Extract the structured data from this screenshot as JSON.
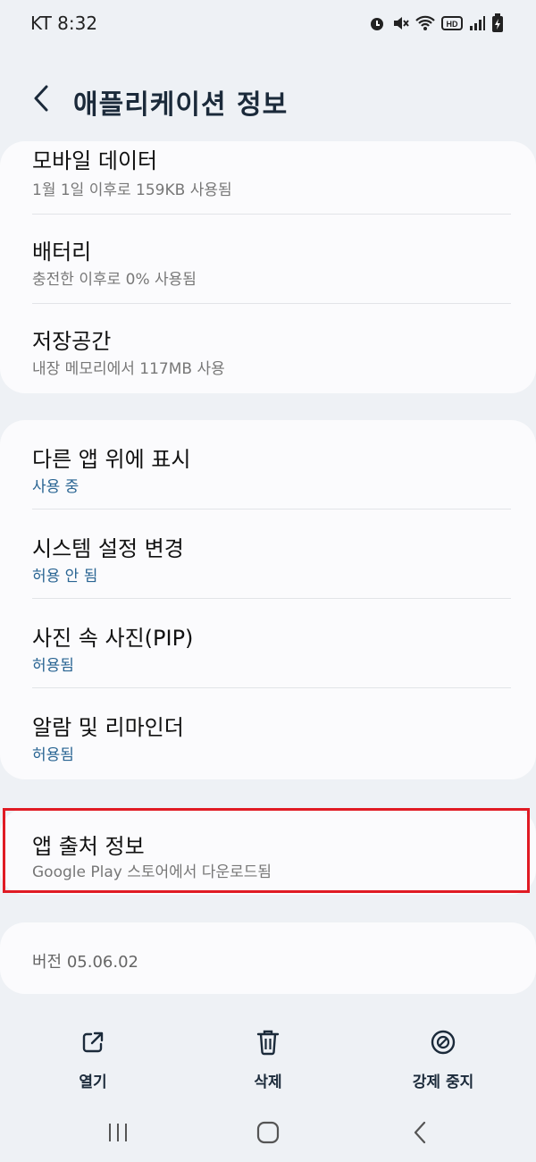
{
  "status_bar": {
    "carrier_time": "KT 8:32",
    "icons": [
      "alarm-icon",
      "mute-icon",
      "wifi-icon",
      "hd-icon",
      "signal-icon",
      "battery-icon"
    ]
  },
  "header": {
    "title": "애플리케이션 정보"
  },
  "usage_section": {
    "items": [
      {
        "title": "모바일 데이터",
        "sub": "1월 1일 이후로 159KB 사용됨"
      },
      {
        "title": "배터리",
        "sub": "충전한 이후로 0% 사용됨"
      },
      {
        "title": "저장공간",
        "sub": "내장 메모리에서 117MB 사용"
      }
    ]
  },
  "permissions_section": {
    "items": [
      {
        "title": "다른 앱 위에 표시",
        "sub": "사용 중"
      },
      {
        "title": "시스템 설정 변경",
        "sub": "허용 안 됨"
      },
      {
        "title": "사진 속 사진(PIP)",
        "sub": "허용됨"
      },
      {
        "title": "알람 및 리마인더",
        "sub": "허용됨"
      }
    ]
  },
  "source_section": {
    "title": "앱 출처 정보",
    "sub": "Google Play 스토어에서 다운로드됨"
  },
  "version": "버전 05.06.02",
  "actions": {
    "open": "열기",
    "delete": "삭제",
    "force_stop": "강제 중지"
  },
  "colors": {
    "background": "#eef1f5",
    "card": "#fbfbfd",
    "accent_blue": "#2a6593",
    "highlight": "#e01b24"
  }
}
